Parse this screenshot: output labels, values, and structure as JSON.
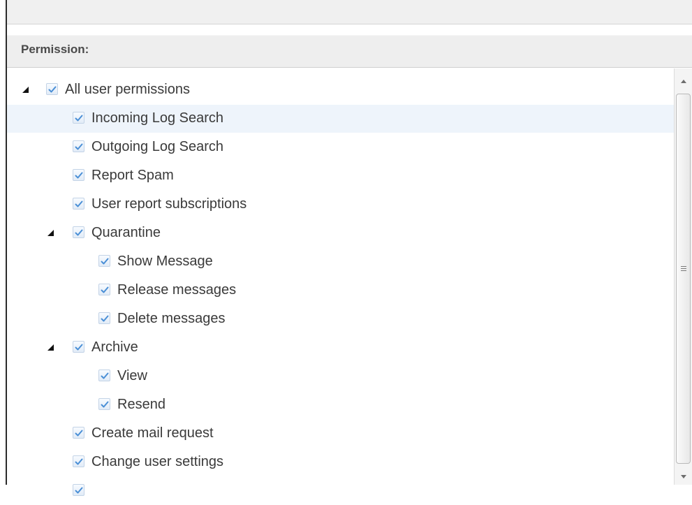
{
  "panel": {
    "header_label": "Permission:"
  },
  "tree": {
    "items": [
      {
        "label": "All user permissions",
        "level": 0,
        "expandable": true,
        "checked": true,
        "highlighted": false
      },
      {
        "label": "Incoming Log Search",
        "level": 1,
        "expandable": false,
        "checked": true,
        "highlighted": true
      },
      {
        "label": "Outgoing Log Search",
        "level": 1,
        "expandable": false,
        "checked": true,
        "highlighted": false
      },
      {
        "label": "Report Spam",
        "level": 1,
        "expandable": false,
        "checked": true,
        "highlighted": false
      },
      {
        "label": "User report subscriptions",
        "level": 1,
        "expandable": false,
        "checked": true,
        "highlighted": false
      },
      {
        "label": "Quarantine",
        "level": 1,
        "expandable": true,
        "checked": true,
        "highlighted": false
      },
      {
        "label": "Show Message",
        "level": 2,
        "expandable": false,
        "checked": true,
        "highlighted": false
      },
      {
        "label": "Release messages",
        "level": 2,
        "expandable": false,
        "checked": true,
        "highlighted": false
      },
      {
        "label": "Delete messages",
        "level": 2,
        "expandable": false,
        "checked": true,
        "highlighted": false
      },
      {
        "label": "Archive",
        "level": 1,
        "expandable": true,
        "checked": true,
        "highlighted": false
      },
      {
        "label": "View",
        "level": 2,
        "expandable": false,
        "checked": true,
        "highlighted": false
      },
      {
        "label": "Resend",
        "level": 2,
        "expandable": false,
        "checked": true,
        "highlighted": false
      },
      {
        "label": "Create mail request",
        "level": 1,
        "expandable": false,
        "checked": true,
        "highlighted": false
      },
      {
        "label": "Change user settings",
        "level": 1,
        "expandable": false,
        "checked": true,
        "highlighted": false
      },
      {
        "label": "",
        "level": 1,
        "expandable": false,
        "checked": true,
        "highlighted": false
      }
    ]
  },
  "colors": {
    "checkmark": "#4a8fd6",
    "highlight": "#eef4fb",
    "header_bg": "#eeeeee"
  },
  "icons": {
    "expand": "triangle-expanded-icon",
    "checkbox": "checkbox-checked-icon",
    "scroll_up": "scroll-up-arrow-icon",
    "scroll_down": "scroll-down-arrow-icon"
  }
}
